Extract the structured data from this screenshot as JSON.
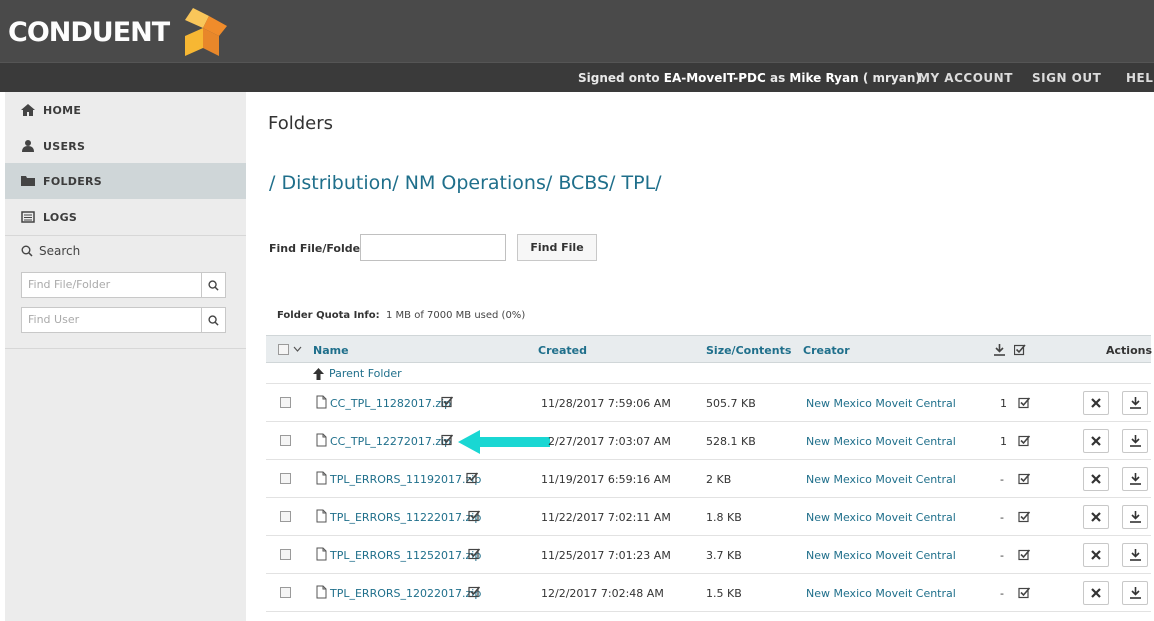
{
  "brand": {
    "name": "CONDUENT"
  },
  "navbar": {
    "signed_prefix": "Signed onto",
    "server": "EA-MoveIT-PDC",
    "as": "as",
    "user": "Mike Ryan",
    "username": "( mryan).",
    "my_account": "MY ACCOUNT",
    "sign_out": "SIGN OUT",
    "help": "HELP"
  },
  "sidebar": {
    "items": [
      {
        "label": "HOME",
        "icon": "home-icon"
      },
      {
        "label": "USERS",
        "icon": "user-icon"
      },
      {
        "label": "FOLDERS",
        "icon": "folder-icon"
      },
      {
        "label": "LOGS",
        "icon": "logs-icon"
      }
    ],
    "search_title": "Search",
    "find_file_placeholder": "Find File/Folder",
    "find_user_placeholder": "Find User"
  },
  "main": {
    "title": "Folders",
    "breadcrumb": [
      "/ Distribution/",
      "NM Operations/",
      "BCBS/",
      "TPL/"
    ],
    "find_label": "Find File/Folder:",
    "find_value": "",
    "find_button": "Find File",
    "quota_label": "Folder Quota Info:",
    "quota_value": "1 MB of 7000 MB used (0%)"
  },
  "table": {
    "headers": {
      "name": "Name",
      "created": "Created",
      "size": "Size/Contents",
      "creator": "Creator",
      "actions": "Actions"
    },
    "parent_folder": "Parent Folder",
    "rows": [
      {
        "name": "CC_TPL_11282017.zip",
        "created": "11/28/2017 7:59:06 AM",
        "size": "505.7 KB",
        "creator": "New Mexico Moveit Central",
        "downloads": "1"
      },
      {
        "name": "CC_TPL_12272017.zip",
        "created": "2/27/2017 7:03:07 AM",
        "size": "528.1 KB",
        "creator": "New Mexico Moveit Central",
        "downloads": "1"
      },
      {
        "name": "TPL_ERRORS_11192017.zip",
        "created": "11/19/2017 6:59:16 AM",
        "size": "2 KB",
        "creator": "New Mexico Moveit Central",
        "downloads": "-"
      },
      {
        "name": "TPL_ERRORS_11222017.zip",
        "created": "11/22/2017 7:02:11 AM",
        "size": "1.8 KB",
        "creator": "New Mexico Moveit Central",
        "downloads": "-"
      },
      {
        "name": "TPL_ERRORS_11252017.zip",
        "created": "11/25/2017 7:01:23 AM",
        "size": "3.7 KB",
        "creator": "New Mexico Moveit Central",
        "downloads": "-"
      },
      {
        "name": "TPL_ERRORS_12022017.zip",
        "created": "12/2/2017 7:02:48 AM",
        "size": "1.5 KB",
        "creator": "New Mexico Moveit Central",
        "downloads": "-"
      }
    ]
  },
  "colors": {
    "accent": "#1f6f8b",
    "banner": "#4a4a4a",
    "arrow": "#19d7d3",
    "logo_orange": "#f5a623"
  }
}
